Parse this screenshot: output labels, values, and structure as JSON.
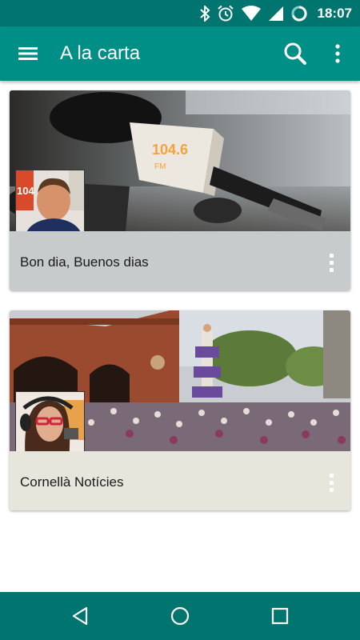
{
  "status_bar": {
    "time": "18:07",
    "icons": [
      "bluetooth-icon",
      "alarm-icon",
      "wifi-icon",
      "signal-icon",
      "battery-charging-icon"
    ]
  },
  "app_bar": {
    "title": "A la carta",
    "menu_icon": "hamburger-menu-icon",
    "search_icon": "search-icon",
    "overflow_icon": "more-vert-icon"
  },
  "cards": [
    {
      "label": "Bon dia, Buenos dias",
      "image": "radio-microphone-photo",
      "avatar": "presenter-man-photo",
      "footer_color": "#c7cbcb"
    },
    {
      "label": "Cornellà Notícies",
      "image": "human-tower-crowd-photo",
      "avatar": "presenter-woman-photo",
      "footer_color": "#e7e6dc"
    }
  ],
  "nav_bar": {
    "items": [
      "back-icon",
      "home-icon",
      "recents-icon"
    ]
  },
  "colors": {
    "status_bar": "#00756f",
    "app_bar": "#008f86",
    "nav_bar": "#00756f"
  }
}
